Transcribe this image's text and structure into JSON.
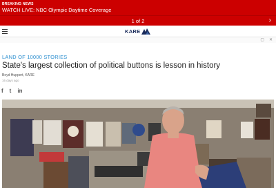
{
  "breaking": {
    "tag": "BREAKING NEWS",
    "headline": "WATCH LIVE: NBC Olympic Daytime Coverage"
  },
  "pager": {
    "current": "1 of 2",
    "next_icon": "chevron-right-icon"
  },
  "header": {
    "menu_icon": "hamburger-menu-icon",
    "logo_text": "KARE"
  },
  "article": {
    "section": "LAND OF 10000 STORIES",
    "title": "State's largest collection of political buttons is lesson in history",
    "byline": "Boyd Huppert, KARE",
    "date": "16 days ago",
    "share": [
      "f",
      "t",
      "in"
    ]
  },
  "colors": {
    "breaking_red": "#cc0000",
    "section_blue": "#2b8ecf",
    "title_text": "#222222"
  }
}
